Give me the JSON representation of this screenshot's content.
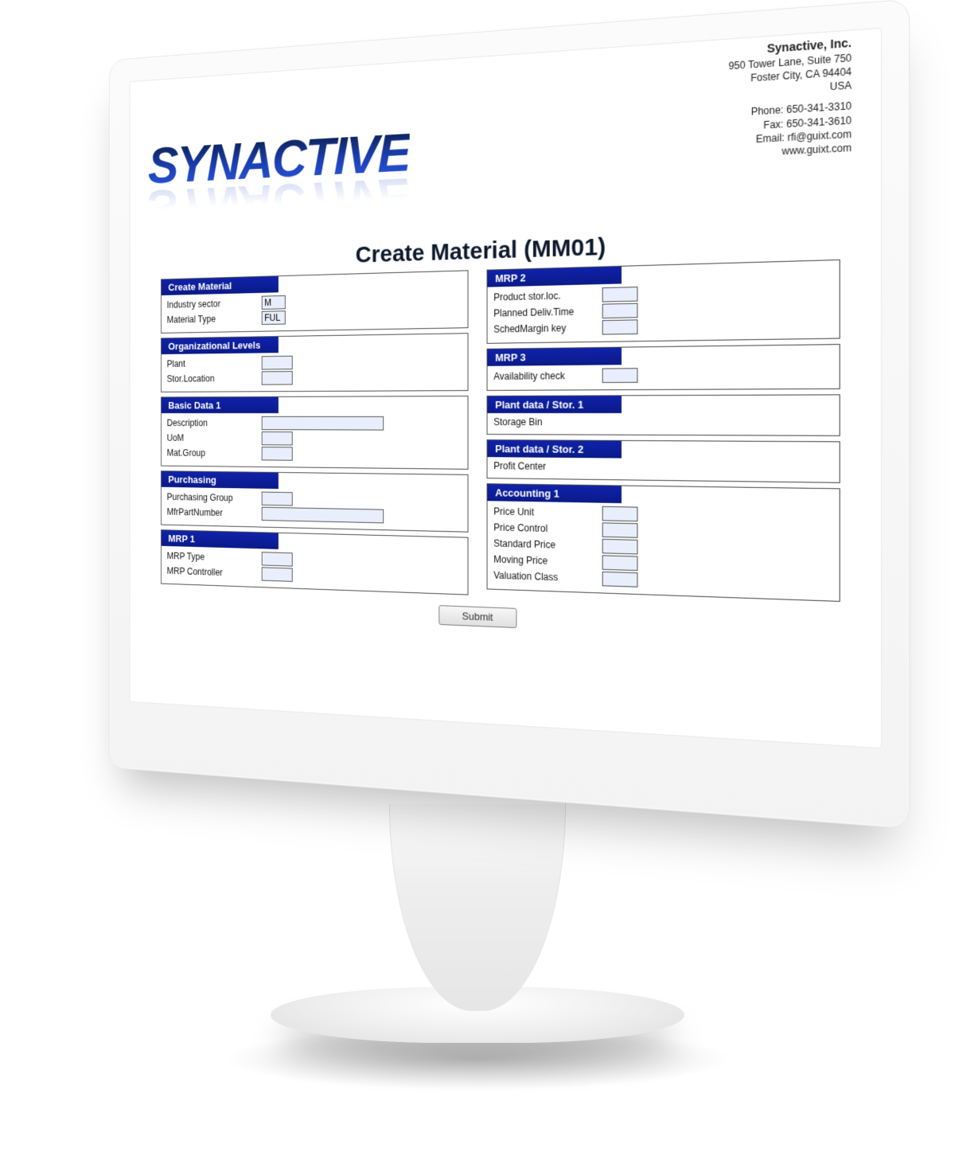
{
  "logo_text": "SYNACTIVE",
  "company": {
    "name": "Synactive, Inc.",
    "line1": "950 Tower Lane, Suite 750",
    "line2": "Foster City, CA 94404",
    "line3": "USA",
    "phone": "Phone: 650-341-3310",
    "fax": "Fax: 650-341-3610",
    "email": "Email: rfi@guixt.com",
    "web": "www.guixt.com"
  },
  "page_title": "Create Material (MM01)",
  "left_sections": [
    {
      "title": "Create Material",
      "fields": [
        {
          "label": "Industry sector",
          "size": "sm",
          "value": "M"
        },
        {
          "label": "Material Type",
          "size": "sm",
          "value": "FUL"
        }
      ]
    },
    {
      "title": "Organizational Levels",
      "fields": [
        {
          "label": "Plant",
          "size": "field",
          "value": ""
        },
        {
          "label": "Stor.Location",
          "size": "field",
          "value": ""
        }
      ]
    },
    {
      "title": "Basic Data 1",
      "fields": [
        {
          "label": "Description",
          "size": "lg",
          "value": ""
        },
        {
          "label": "UoM",
          "size": "field",
          "value": ""
        },
        {
          "label": "Mat.Group",
          "size": "field",
          "value": ""
        }
      ]
    },
    {
      "title": "Purchasing",
      "fields": [
        {
          "label": "Purchasing Group",
          "size": "field",
          "value": ""
        },
        {
          "label": "MfrPartNumber",
          "size": "lg",
          "value": ""
        }
      ]
    },
    {
      "title": "MRP 1",
      "fields": [
        {
          "label": "MRP Type",
          "size": "field",
          "value": ""
        },
        {
          "label": "MRP Controller",
          "size": "field",
          "value": ""
        }
      ]
    }
  ],
  "right_sections": [
    {
      "title": "MRP 2",
      "fields": [
        {
          "label": "Product stor.loc.",
          "size": "field",
          "value": ""
        },
        {
          "label": "Planned Deliv.Time",
          "size": "field",
          "value": ""
        },
        {
          "label": "SchedMargin key",
          "size": "field",
          "value": ""
        }
      ]
    },
    {
      "title": "MRP 3",
      "fields": [
        {
          "label": "Availability check",
          "size": "field",
          "value": ""
        }
      ]
    },
    {
      "title": "Plant data / Stor. 1",
      "fields": [
        {
          "label": "Storage Bin",
          "size": "none",
          "value": ""
        }
      ]
    },
    {
      "title": "Plant data / Stor. 2",
      "fields": [
        {
          "label": "Profit Center",
          "size": "none",
          "value": ""
        }
      ]
    },
    {
      "title": "Accounting 1",
      "fields": [
        {
          "label": "Price Unit",
          "size": "field",
          "value": ""
        },
        {
          "label": "Price Control",
          "size": "field",
          "value": ""
        },
        {
          "label": "Standard Price",
          "size": "field",
          "value": ""
        },
        {
          "label": "Moving Price",
          "size": "field",
          "value": ""
        },
        {
          "label": "Valuation Class",
          "size": "field",
          "value": ""
        }
      ]
    }
  ],
  "submit_label": "Submit"
}
